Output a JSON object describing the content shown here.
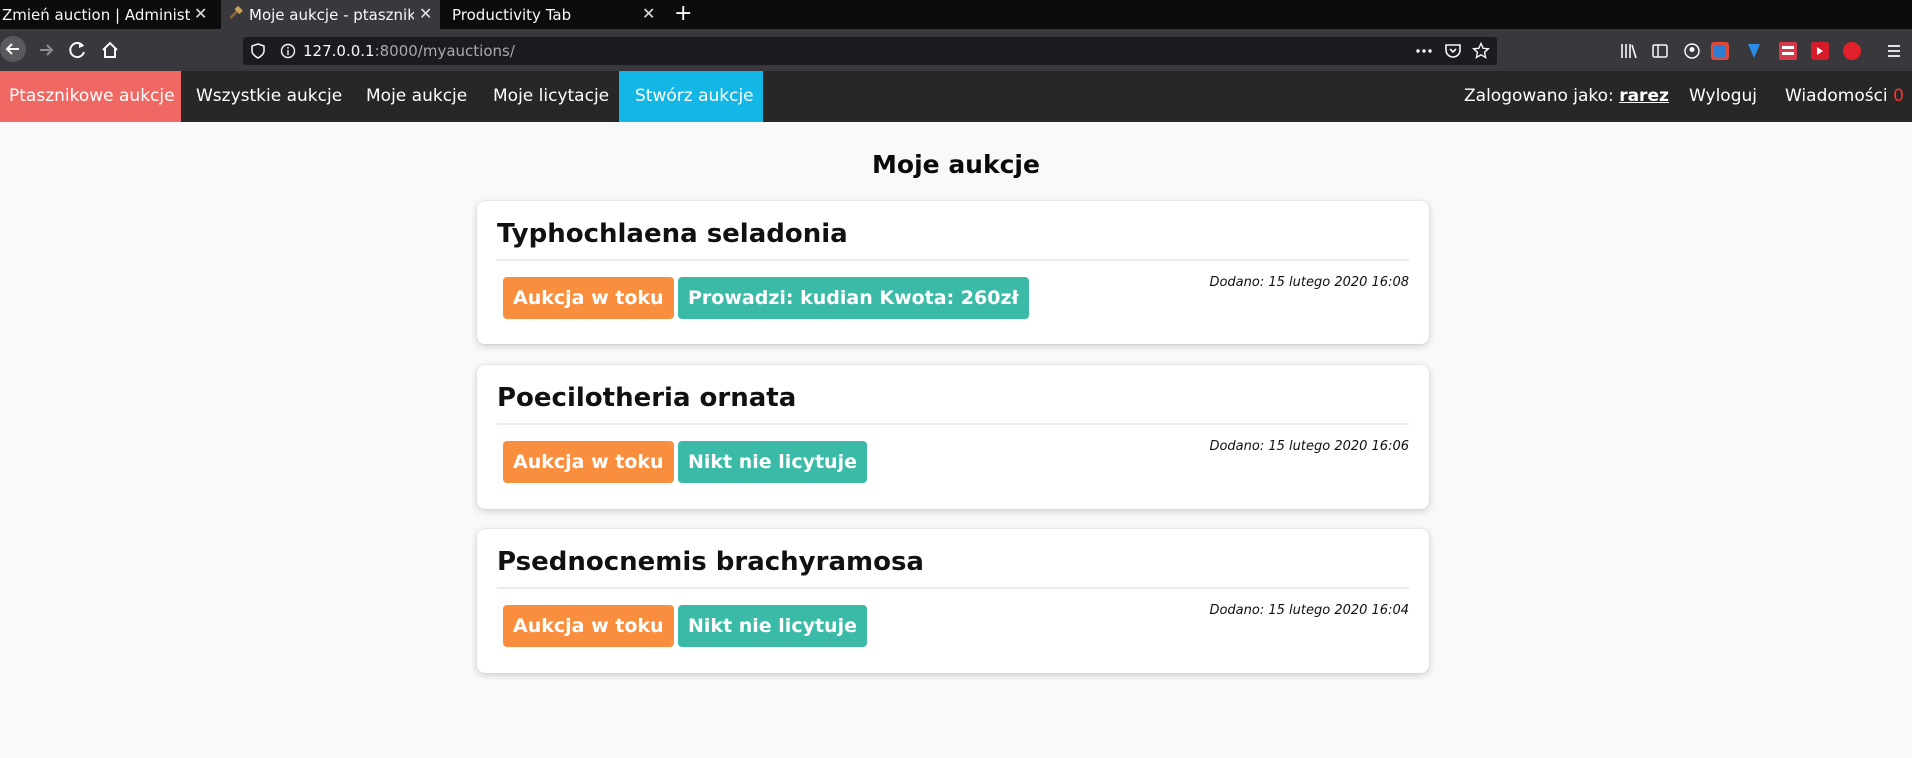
{
  "browser": {
    "tabs": [
      {
        "title": "Zmień auction | Administracja",
        "close": "✕"
      },
      {
        "title": "Moje aukcje - ptasznikowe aukcje",
        "close": "✕"
      },
      {
        "title": "Productivity Tab",
        "close": "✕"
      }
    ],
    "new_tab": "+",
    "url_host": "127.0.0.1",
    "url_path": ":8000/myauctions/"
  },
  "nav": {
    "brand": "Ptasznikowe aukcje",
    "items": [
      "Wszystkie aukcje",
      "Moje aukcje",
      "Moje licytacje",
      "Stwórz aukcje"
    ],
    "logged_prefix": "Zalogowano jako: ",
    "username": "rarez",
    "logout": "Wyloguj",
    "messages": "Wiadomości",
    "messages_count": "0"
  },
  "main": {
    "title": "Moje aukcje",
    "auctions": [
      {
        "name": "Typhochlaena seladonia",
        "status": "Aukcja w toku",
        "bid": "Prowadzi: kudian Kwota: 260zł",
        "date": "Dodano: 15 lutego 2020 16:08"
      },
      {
        "name": "Poecilotheria ornata",
        "status": "Aukcja w toku",
        "bid": "Nikt nie licytuje",
        "date": "Dodano: 15 lutego 2020 16:06"
      },
      {
        "name": "Psednocnemis brachyramosa",
        "status": "Aukcja w toku",
        "bid": "Nikt nie licytuje",
        "date": "Dodano: 15 lutego 2020 16:04"
      }
    ]
  },
  "colors": {
    "brand": "#ef6863",
    "create": "#13b7e5",
    "status_badge": "#f98f3e",
    "bid_badge": "#3bbba7"
  }
}
